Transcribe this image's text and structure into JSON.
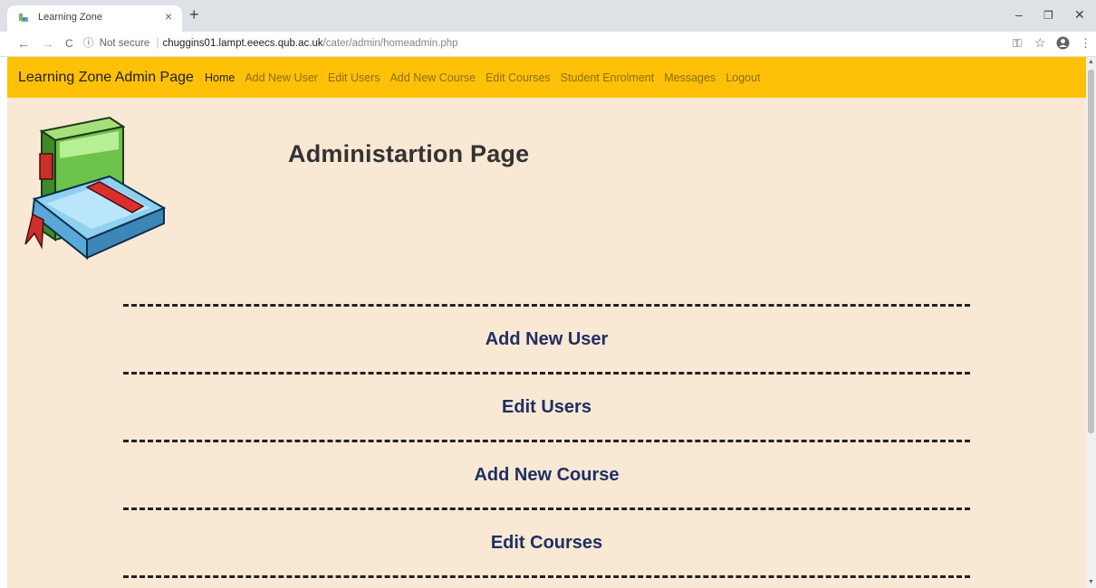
{
  "browser": {
    "tab_title": "Learning Zone",
    "tab_close": "×",
    "new_tab": "+",
    "back": "←",
    "forward": "→",
    "reload": "C",
    "security_icon": "ⓘ",
    "security_label": "Not secure",
    "separator": "|",
    "url_host": "chuggins01.lampt.eeecs.qub.ac.uk",
    "url_path": "/cater/admin/homeadmin.php",
    "key_icon": "⚿",
    "star_icon": "☆",
    "profile_icon": "●",
    "menu_icon": "⋮",
    "minimize": "–",
    "restore": "❐",
    "close": "✕"
  },
  "site": {
    "brand": "Learning Zone Admin Page",
    "nav": [
      {
        "label": "Home",
        "active": true
      },
      {
        "label": "Add New User",
        "active": false
      },
      {
        "label": "Edit Users",
        "active": false
      },
      {
        "label": "Add New Course",
        "active": false
      },
      {
        "label": "Edit Courses",
        "active": false
      },
      {
        "label": "Student Enrolment",
        "active": false
      },
      {
        "label": "Messages",
        "active": false
      },
      {
        "label": "Logout",
        "active": false
      }
    ],
    "heading": "Administartion Page",
    "menu_links": [
      "Add New User",
      "Edit Users",
      "Add New Course",
      "Edit Courses"
    ]
  },
  "colors": {
    "navbar": "#ffc107",
    "page_bg": "#f9e8d4",
    "link": "#1f2f63",
    "nav_link": "#8a6d14"
  }
}
